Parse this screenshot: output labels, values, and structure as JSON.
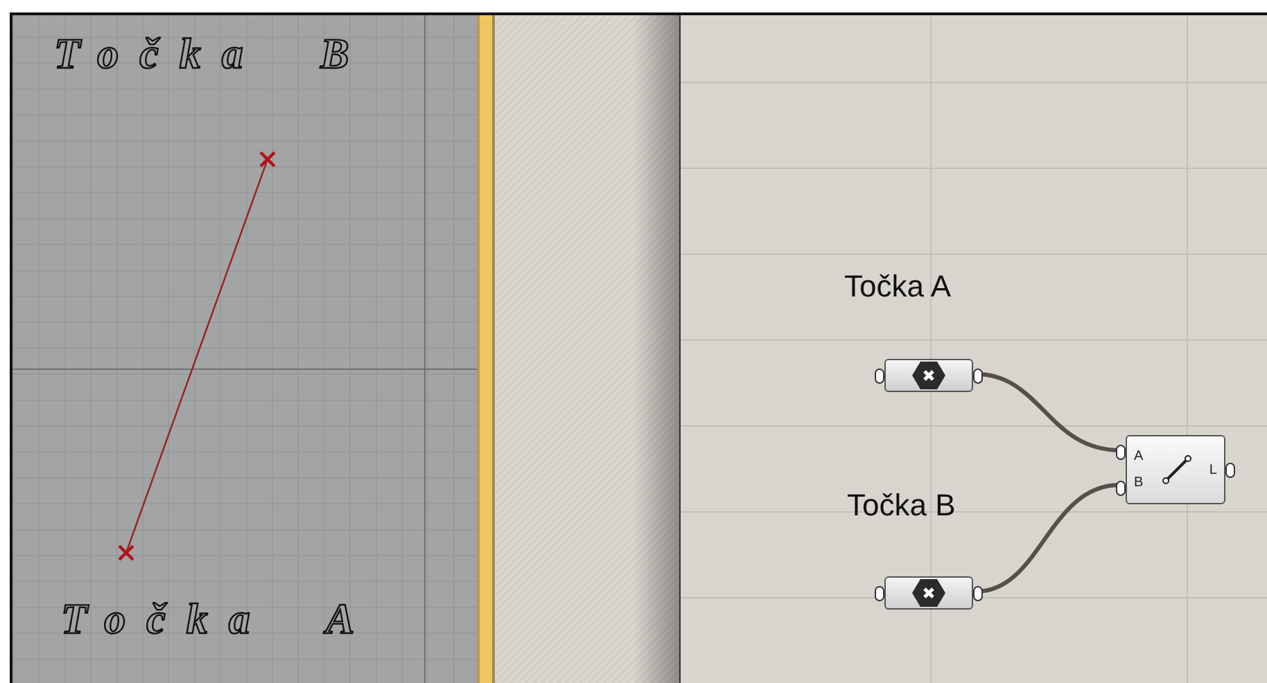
{
  "viewport": {
    "labels": [
      {
        "text": "Točka B"
      },
      {
        "text": "Točka A"
      }
    ]
  },
  "canvas": {
    "labels": [
      "Točka A",
      "Točka B"
    ],
    "component": {
      "inputs": [
        "A",
        "B"
      ],
      "outputs": [
        "L"
      ]
    }
  }
}
